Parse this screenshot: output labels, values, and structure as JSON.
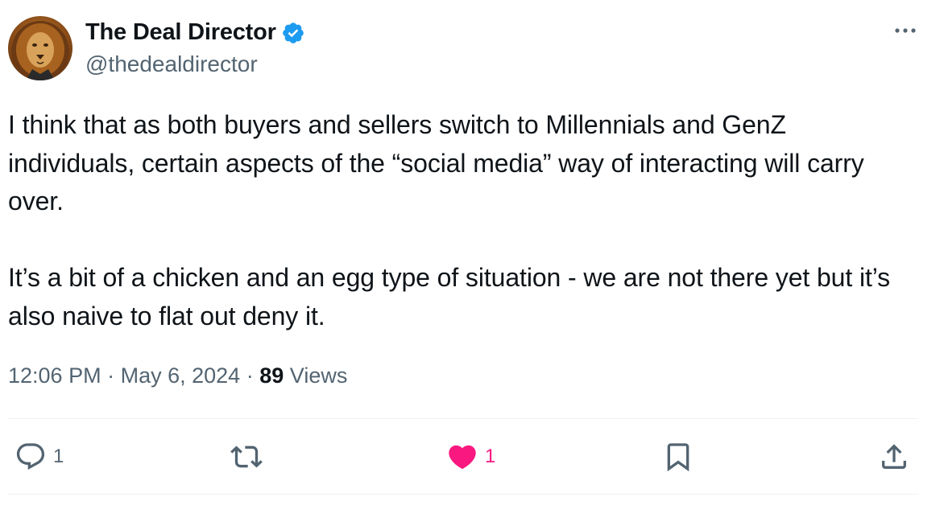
{
  "author": {
    "display_name": "The Deal Director",
    "handle": "@thedealdirector",
    "verified": true,
    "avatar_icon": "lion-avatar"
  },
  "tweet": {
    "text": "I think that as both buyers and sellers switch to Millennials and GenZ individuals, certain aspects of the “social media” way of interacting will carry over.\n\nIt’s a bit of a chicken and an egg type of situation - we are not there yet but it’s also naive to flat out deny it.",
    "time": "12:06 PM",
    "separator": "·",
    "date": "May 6, 2024",
    "views_count": "89",
    "views_label": "Views"
  },
  "actions": {
    "reply": {
      "icon": "reply-icon",
      "count": "1"
    },
    "retweet": {
      "icon": "retweet-icon",
      "count": ""
    },
    "like": {
      "icon": "heart-icon",
      "count": "1",
      "liked": true
    },
    "bookmark": {
      "icon": "bookmark-icon",
      "count": ""
    },
    "share": {
      "icon": "share-icon",
      "count": ""
    }
  },
  "colors": {
    "verified_blue": "#1d9bf0",
    "like_pink": "#f91880",
    "secondary_text": "#536471",
    "divider": "#eff3f4"
  }
}
